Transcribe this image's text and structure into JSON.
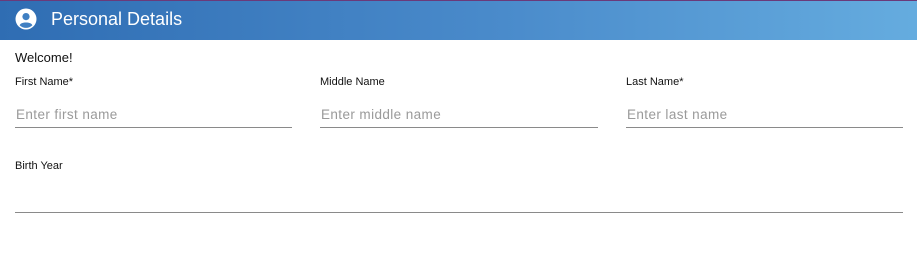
{
  "header": {
    "title": "Personal Details",
    "icon": "user-circle-icon",
    "gradient_colors": [
      "#2f6db3",
      "#65acdf"
    ]
  },
  "form": {
    "welcome": "Welcome!",
    "first_name": {
      "label": "First Name*",
      "placeholder": "Enter first name",
      "value": ""
    },
    "middle_name": {
      "label": "Middle Name",
      "placeholder": "Enter middle name",
      "value": ""
    },
    "last_name": {
      "label": "Last Name*",
      "placeholder": "Enter last name",
      "value": ""
    },
    "birth_year": {
      "label": "Birth Year",
      "placeholder": "",
      "value": ""
    }
  }
}
